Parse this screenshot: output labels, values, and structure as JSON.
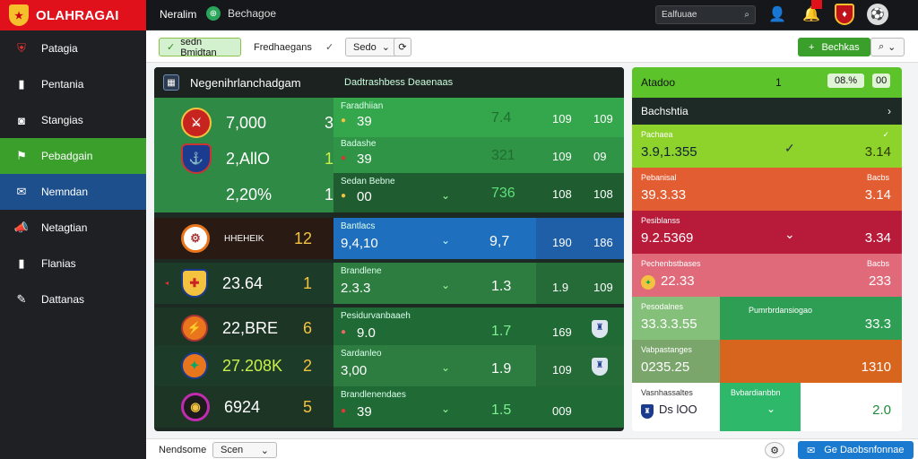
{
  "brand": {
    "name": "OLAHRAGAI"
  },
  "topbar": {
    "title": "Neralim",
    "sub": "Bechagoe",
    "search": "Ealfuuae"
  },
  "sidebar": [
    {
      "label": "Patagia",
      "icon": "shield-icon"
    },
    {
      "label": "Pentania",
      "icon": "tablet-icon"
    },
    {
      "label": "Stangias",
      "icon": "camera-icon"
    },
    {
      "label": "Pebadgain",
      "icon": "flag-icon"
    },
    {
      "label": "Nemndan",
      "icon": "mail-icon"
    },
    {
      "label": "Netagtian",
      "icon": "megaphone-icon"
    },
    {
      "label": "Flanias",
      "icon": "tablet-icon"
    },
    {
      "label": "Dattanas",
      "icon": "pen-icon"
    }
  ],
  "toolbar": {
    "filter": "sedn Bmidtan",
    "chip2": "Fredhaegans",
    "select": "Sedo",
    "action": "Bechkas"
  },
  "panel": {
    "title": "Negenihrlanchadgam",
    "sub": "Dadtrashbess Deaenaas"
  },
  "match1": {
    "team_values": [
      "7,000",
      "2,AllO",
      "2,20%"
    ],
    "team_nums": [
      "3",
      "1",
      "1"
    ],
    "lines": [
      {
        "label": "Faradhiian",
        "val": "39",
        "odd": "7.4",
        "c1": "109",
        "c2": "109"
      },
      {
        "label": "Badashe",
        "val": "39",
        "odd": "321",
        "c1": "109",
        "c2": "09"
      },
      {
        "label": "Sedan Bebne",
        "val": "00",
        "odd": "736",
        "c1": "108",
        "c2": "108"
      }
    ]
  },
  "rows": [
    {
      "lval": "HHEHEIK",
      "lnum": "12",
      "label": "Bantlacs",
      "val": "9,4,10",
      "odd": "9,7",
      "c1": "190",
      "c2": "186"
    },
    {
      "lval": "23.64",
      "lnum": "1",
      "label": "Brandlene",
      "val": "2.3.3",
      "odd": "1.3",
      "c1": "1.9",
      "c2": "109"
    },
    {
      "lval": "22,BRE",
      "lnum": "6",
      "label": "Pesidurvanbaaeh",
      "val": "9.0",
      "odd": "1.7",
      "c1": "169",
      "c2": ""
    },
    {
      "lval": "27.208K",
      "lnum": "2",
      "label": "Sardanleo",
      "val": "3,00",
      "odd": "1.9",
      "c1": "109",
      "c2": ""
    },
    {
      "lval": "6924",
      "lnum": "5",
      "label": "Brandlenendaes",
      "val": "39",
      "odd": "1.5",
      "c1": "009",
      "c2": ""
    }
  ],
  "rpanel": {
    "head": "Atadoo",
    "head_num": "1",
    "head_pct": "08.%",
    "head_dots": "00",
    "sub": "Bachshtia",
    "rows": [
      {
        "label": "Pachaea",
        "val": "3.9,1.355",
        "right": "3.14",
        "mid": "",
        "side": ""
      },
      {
        "label": "Pebanisal",
        "val": "39.3.33",
        "right": "3.14",
        "mid": "",
        "side": "Bacbs"
      },
      {
        "label": "Pesiblanss",
        "val": "9.2.5369",
        "right": "3.34",
        "mid": "",
        "side": ""
      },
      {
        "label": "Pechenbstbases",
        "val": "22.33",
        "right": "233",
        "mid": "",
        "side": "Bacbs"
      },
      {
        "label": "Pesodalnes",
        "val": "33.3.3.55",
        "right": "33.3",
        "mid": "Pumrbrdansiogao",
        "side": ""
      },
      {
        "label": "Vabpastanges",
        "val": "0235.25",
        "right": "1310",
        "mid": "",
        "side": ""
      },
      {
        "label": "Vasnhassaltes",
        "val": "Ds lOO",
        "right": "2.0",
        "mid": "Bvbardianbbn",
        "side": ""
      }
    ]
  },
  "footer": {
    "f1": "Nendsome",
    "f2": "Scen",
    "action": "Ge Daobsnfonnae"
  }
}
